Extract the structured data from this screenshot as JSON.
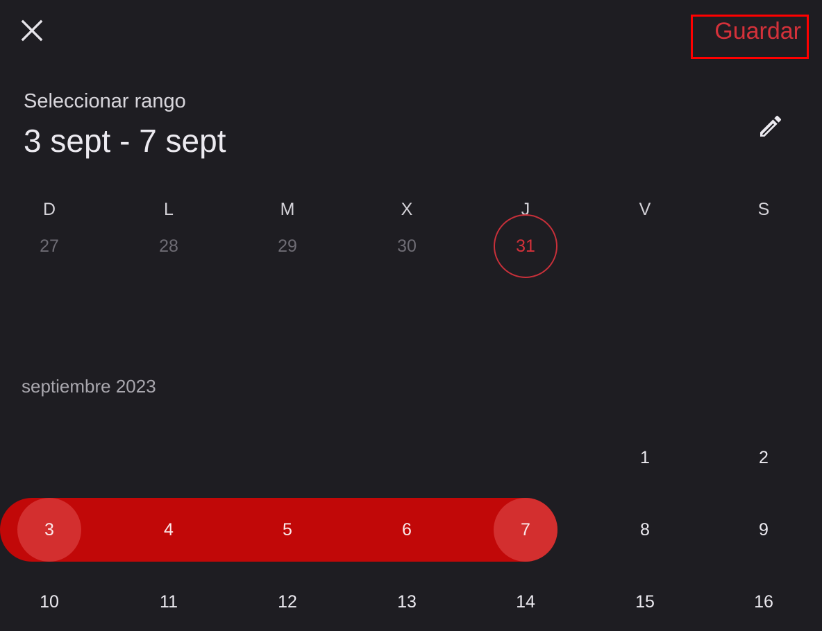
{
  "header": {
    "close_icon": "close-icon",
    "save_label": "Guardar"
  },
  "selection": {
    "label": "Seleccionar rango",
    "range": "3 sept - 7 sept",
    "edit_icon": "pencil-icon"
  },
  "weekdays": [
    "D",
    "L",
    "M",
    "X",
    "J",
    "V",
    "S"
  ],
  "previous_month_tail": [
    "27",
    "28",
    "29",
    "30",
    "31"
  ],
  "today": "31",
  "month": {
    "label": "septiembre 2023",
    "weeks": [
      [
        "",
        "",
        "",
        "",
        "",
        "1",
        "2"
      ],
      [
        "3",
        "4",
        "5",
        "6",
        "7",
        "8",
        "9"
      ],
      [
        "10",
        "11",
        "12",
        "13",
        "14",
        "15",
        "16"
      ]
    ]
  },
  "selected_range": {
    "start": "3",
    "end": "7"
  },
  "colors": {
    "background": "#1e1d22",
    "accent": "#d32f2f",
    "range_band": "#c10808",
    "highlight_box": "#ff0000"
  }
}
